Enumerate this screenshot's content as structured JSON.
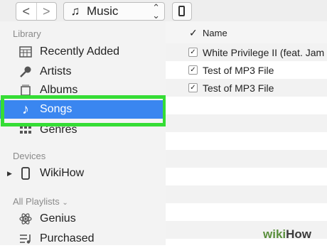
{
  "toolbar": {
    "back_symbol": "<",
    "forward_symbol": ">",
    "source_icon": "music-note-icon",
    "source_label": "Music",
    "device_icon": "iphone-icon"
  },
  "sidebar": {
    "library_header": "Library",
    "library_items": [
      {
        "label": "Recently Added",
        "icon": "calendar-grid-icon"
      },
      {
        "label": "Artists",
        "icon": "microphone-icon"
      },
      {
        "label": "Albums",
        "icon": "album-icon"
      },
      {
        "label": "Songs",
        "icon": "music-note-icon",
        "selected": true
      },
      {
        "label": "Genres",
        "icon": "genres-icon"
      }
    ],
    "devices_header": "Devices",
    "device": {
      "label": "WikiHow",
      "icon": "iphone-icon"
    },
    "playlists_header": "All Playlists",
    "playlists": [
      {
        "label": "Genius",
        "icon": "atom-icon"
      },
      {
        "label": "Purchased",
        "icon": "playlist-icon"
      }
    ],
    "highlight_color": "#35dd35",
    "selection_color": "#3a86f0"
  },
  "table": {
    "check_column": "✓",
    "name_column": "Name",
    "rows": [
      {
        "checked": true,
        "title": "White Privilege II (feat. Jam"
      },
      {
        "checked": true,
        "title": "Test of MP3 File"
      },
      {
        "checked": true,
        "title": "Test of MP3 File"
      }
    ]
  },
  "watermark": {
    "wiki": "wiki",
    "how": "How"
  }
}
